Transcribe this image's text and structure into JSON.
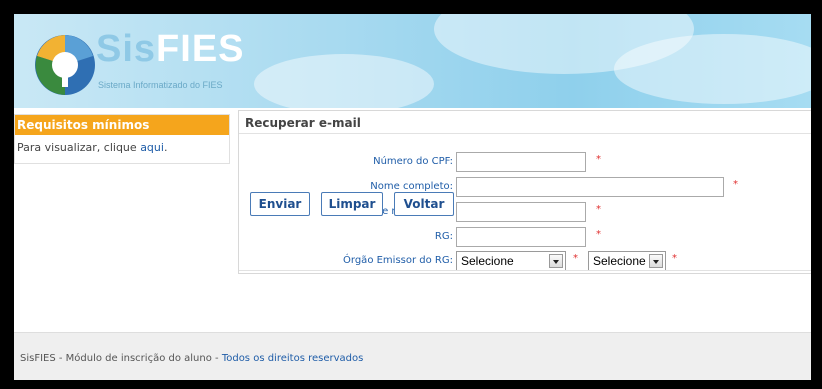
{
  "header": {
    "logo_sis": "Sis",
    "logo_fies": "FIES",
    "logo_subtitle": "Sistema Informatizado do FIES"
  },
  "sidebar": {
    "title": "Requisitos mínimos",
    "text_prefix": "Para visualizar, clique",
    "link": "aqui",
    "text_suffix": "."
  },
  "form": {
    "title": "Recuperar e-mail",
    "fields": [
      {
        "label": "Número do CPF:",
        "value": "",
        "required": "*"
      },
      {
        "label": "Nome completo:",
        "value": "",
        "required": "*"
      },
      {
        "label": "Data de nascimento:",
        "value": "",
        "required": "*"
      },
      {
        "label": "RG:",
        "value": "",
        "required": "*"
      },
      {
        "label": "Órgão Emissor do RG:",
        "select1": "Selecione",
        "select2": "Selecione",
        "required": "*"
      }
    ]
  },
  "buttons": {
    "enviar": "Enviar",
    "limpar": "Limpar",
    "voltar": "Voltar"
  },
  "footer": {
    "part1": "SisFIES - Módulo de inscrição do aluno -",
    "part2": "Todos os direitos reservados"
  },
  "colors": {
    "accent_orange": "#f5a51c",
    "link_blue": "#1f5da8",
    "required_red": "#e03030"
  }
}
